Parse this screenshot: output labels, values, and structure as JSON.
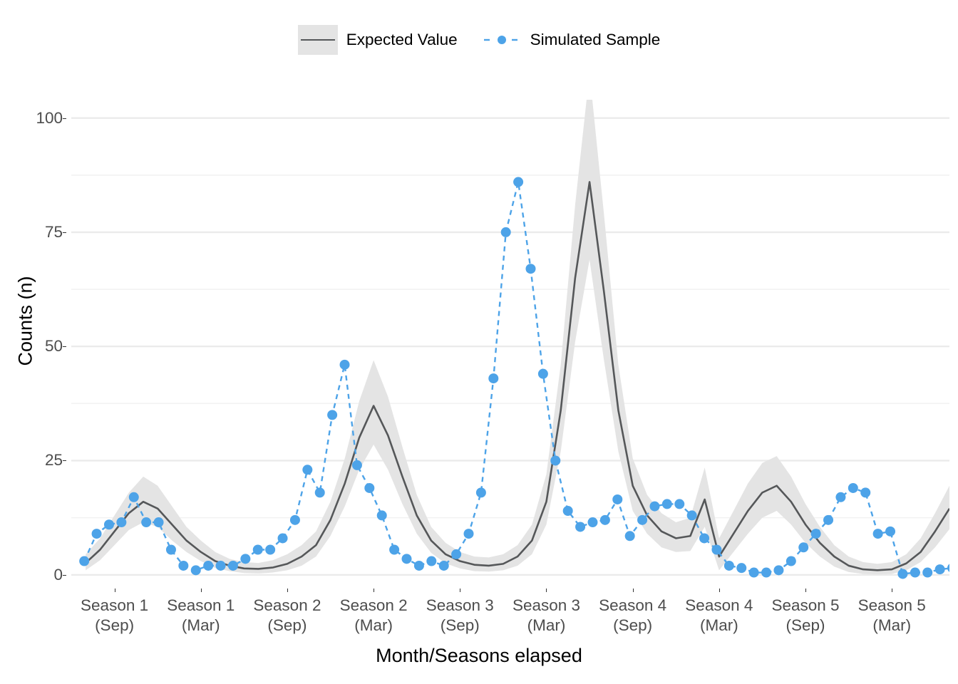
{
  "legend": {
    "position": "top",
    "entries": [
      {
        "label": "Expected Value",
        "key": "ribbon-line-key",
        "line_color": "#555759",
        "ribbon_color": "#e4e4e4"
      },
      {
        "label": "Simulated Sample",
        "key": "dashed-point-key",
        "line_color": "#4da3e8",
        "point_color": "#4da3e8"
      }
    ]
  },
  "axes": {
    "x_title": "Month/Seasons elapsed",
    "y_title": "Counts (n)"
  },
  "chart_data": {
    "type": "line",
    "title": "",
    "subtitle": "",
    "xlabel": "Month/Seasons elapsed",
    "ylabel": "Counts (n)",
    "grid": true,
    "legend_position": "top",
    "ylim": [
      -3,
      104
    ],
    "y_ticks": [
      0,
      25,
      50,
      75,
      100
    ],
    "y_tick_labels": [
      "0",
      "25",
      "50",
      "75",
      "100"
    ],
    "y_minor_ticks": [
      12.5,
      37.5,
      62.5,
      87.5
    ],
    "xlim": [
      0,
      61
    ],
    "x_ticks": [
      3,
      9,
      15,
      21,
      27,
      33,
      39,
      45,
      51,
      57
    ],
    "x_tick_labels": [
      {
        "line1": "Season 1",
        "line2": "(Sep)"
      },
      {
        "line1": "Season 1",
        "line2": "(Mar)"
      },
      {
        "line1": "Season 2",
        "line2": "(Sep)"
      },
      {
        "line1": "Season 2",
        "line2": "(Mar)"
      },
      {
        "line1": "Season 3",
        "line2": "(Sep)"
      },
      {
        "line1": "Season 3",
        "line2": "(Mar)"
      },
      {
        "line1": "Season 4",
        "line2": "(Sep)"
      },
      {
        "line1": "Season 4",
        "line2": "(Mar)"
      },
      {
        "line1": "Season 5",
        "line2": "(Sep)"
      },
      {
        "line1": "Season 5",
        "line2": "(Mar)"
      }
    ],
    "x": [
      1,
      2,
      3,
      4,
      5,
      6,
      7,
      8,
      9,
      10,
      11,
      12,
      13,
      14,
      15,
      16,
      17,
      18,
      19,
      20,
      21,
      22,
      23,
      24,
      25,
      26,
      27,
      28,
      29,
      30,
      31,
      32,
      33,
      34,
      35,
      36,
      37,
      38,
      39,
      40,
      41,
      42,
      43,
      44,
      45,
      46,
      47,
      48,
      49,
      50,
      51,
      52,
      53,
      54,
      55,
      56,
      57,
      58,
      59,
      60,
      61
    ],
    "series": [
      {
        "name": "Expected Value",
        "type": "line",
        "color": "#555759",
        "style": "solid",
        "values": [
          2.6,
          5.5,
          9.5,
          13.5,
          16.0,
          14.5,
          11.0,
          7.5,
          5.0,
          3.0,
          2.0,
          1.4,
          1.3,
          1.6,
          2.4,
          4.0,
          6.5,
          12.0,
          20.0,
          30.0,
          37.0,
          30.5,
          21.5,
          13.0,
          7.5,
          4.5,
          3.0,
          2.2,
          2.0,
          2.4,
          4.0,
          7.5,
          16.0,
          36.0,
          65.0,
          86.0,
          62.0,
          36.0,
          19.5,
          13.0,
          9.5,
          8.0,
          8.5,
          16.5,
          4.0,
          9.0,
          14.0,
          18.0,
          19.5,
          16.0,
          11.0,
          7.0,
          4.0,
          2.0,
          1.2,
          1.0,
          1.2,
          2.5,
          5.0,
          9.5,
          14.5
        ]
      },
      {
        "name": "Expected Value (upper CI)",
        "type": "ribbon_upper",
        "color": "#e4e4e4",
        "values": [
          4.5,
          8.0,
          13.0,
          18.0,
          21.5,
          19.5,
          15.0,
          10.5,
          7.5,
          5.0,
          3.5,
          2.8,
          2.6,
          3.2,
          4.5,
          6.5,
          9.5,
          16.0,
          25.5,
          38.0,
          47.0,
          39.0,
          28.0,
          17.5,
          10.5,
          7.0,
          5.0,
          4.0,
          3.8,
          4.5,
          6.5,
          11.0,
          22.0,
          46.0,
          81.0,
          110.0,
          79.0,
          46.0,
          25.5,
          17.5,
          13.5,
          11.5,
          12.5,
          23.5,
          8.0,
          14.0,
          20.0,
          24.5,
          26.0,
          21.5,
          15.5,
          10.5,
          6.5,
          4.0,
          2.8,
          2.4,
          2.8,
          4.5,
          8.0,
          13.5,
          19.5
        ]
      },
      {
        "name": "Expected Value (lower CI)",
        "type": "ribbon_lower",
        "color": "#e4e4e4",
        "values": [
          1.0,
          3.2,
          6.5,
          9.8,
          11.5,
          10.5,
          7.5,
          5.0,
          3.0,
          1.5,
          0.8,
          0.4,
          0.3,
          0.5,
          1.0,
          2.0,
          4.0,
          8.5,
          15.0,
          23.0,
          28.5,
          23.0,
          15.5,
          9.0,
          4.8,
          2.5,
          1.4,
          0.8,
          0.7,
          1.0,
          2.0,
          4.5,
          11.0,
          27.0,
          51.0,
          69.0,
          47.0,
          27.0,
          14.0,
          9.0,
          6.0,
          5.0,
          5.2,
          10.5,
          1.0,
          5.0,
          9.0,
          12.5,
          14.0,
          11.0,
          7.0,
          4.0,
          1.8,
          0.6,
          0.2,
          0.1,
          0.2,
          1.0,
          2.8,
          6.0,
          10.0
        ]
      },
      {
        "name": "Simulated Sample",
        "type": "points_dashed",
        "color": "#4da3e8",
        "style": "dashed",
        "values": [
          3.0,
          9.0,
          11.0,
          11.5,
          17.0,
          11.5,
          11.5,
          5.5,
          2.0,
          1.0,
          2.0,
          2.0,
          2.0,
          3.5,
          5.5,
          5.5,
          8.0,
          12.0,
          23.0,
          18.0,
          35.0,
          46.0,
          24.0,
          19.0,
          13.0,
          5.5,
          3.5,
          2.0,
          3.0,
          2.0,
          4.5,
          9.0,
          18.0,
          43.0,
          75.0,
          86.0,
          67.0,
          44.0,
          25.0,
          14.0,
          10.5,
          11.5,
          12.0,
          16.5,
          8.5,
          12.0,
          15.0,
          15.5,
          15.5,
          13.0,
          8.0,
          5.5,
          2.0,
          1.5,
          0.5,
          0.5,
          1.0,
          3.0,
          6.0,
          9.0,
          12.0,
          17.0,
          19.0,
          18.0,
          9.0,
          9.5,
          0.2,
          0.5,
          0.5,
          1.2,
          1.5
        ]
      }
    ]
  }
}
